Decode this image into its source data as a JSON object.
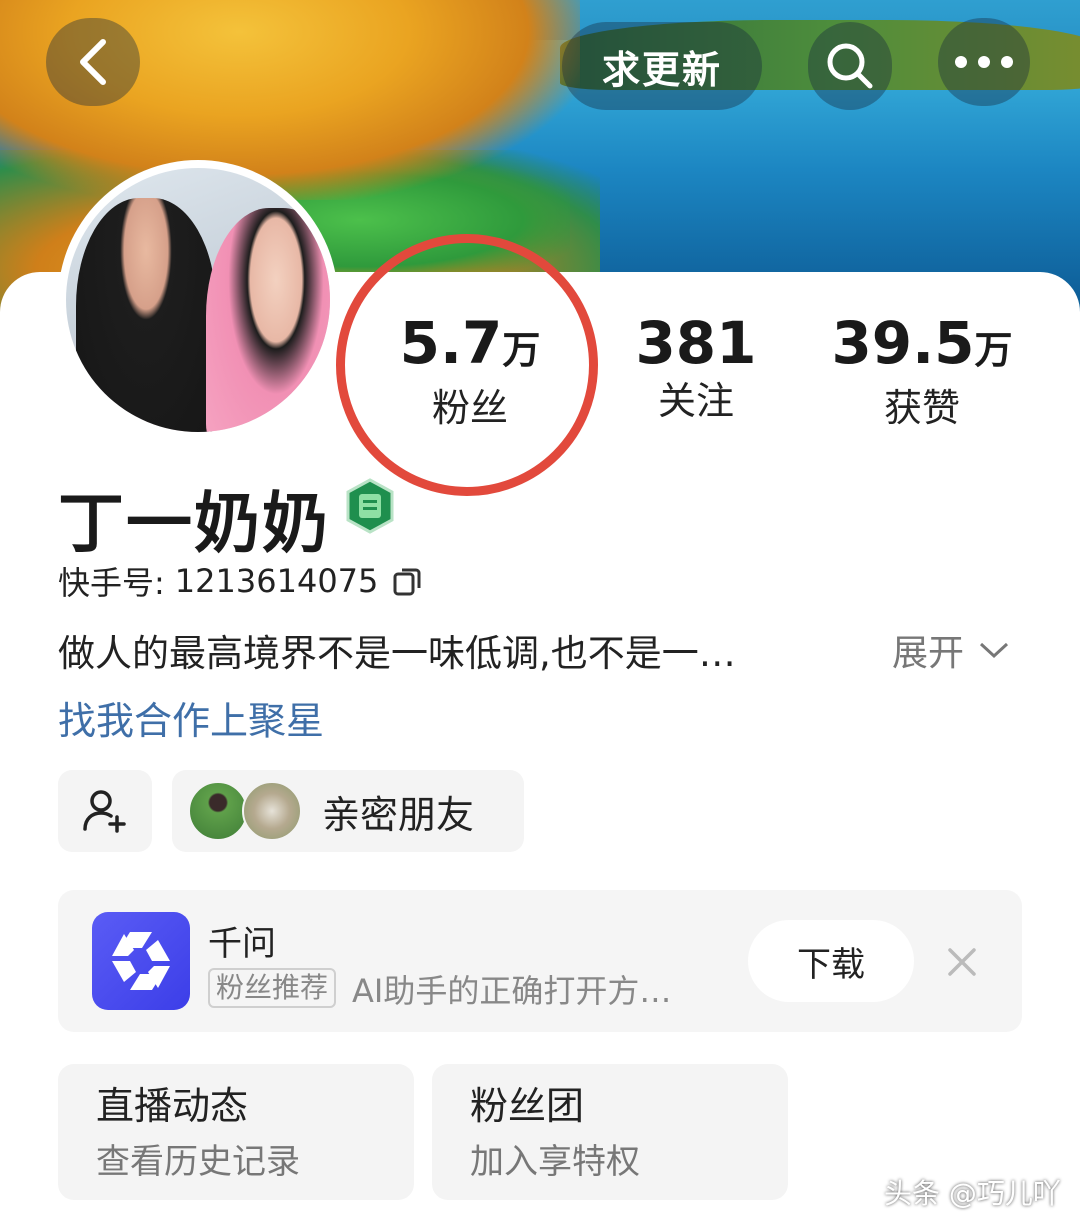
{
  "header": {
    "title": "求更新",
    "back_icon": "chevron-left-icon",
    "search_icon": "search-icon",
    "more_icon": "more-horizontal-icon"
  },
  "stats": {
    "fans": {
      "number": "5.7",
      "unit": "万",
      "label": "粉丝"
    },
    "following": {
      "number": "381",
      "unit": "",
      "label": "关注"
    },
    "likes": {
      "number": "39.5",
      "unit": "万",
      "label": "获赞"
    },
    "highlight_color": "#e2493c"
  },
  "profile": {
    "name": "丁一奶奶",
    "id_label": "快手号:",
    "id_value": "1213614075",
    "bio": "做人的最高境界不是一味低调,也不是一…",
    "expand_label": "展开",
    "cooperate_link": "找我合作上聚星",
    "link_color": "#3f6fa8"
  },
  "friends": {
    "label": "亲密朋友",
    "add_icon": "add-user-icon"
  },
  "promo": {
    "app_name": "千问",
    "tag": "粉丝推荐",
    "desc": "AI助手的正确打开方…",
    "download_label": "下载",
    "icon_color": "#4a4cf0"
  },
  "tiles": [
    {
      "title": "直播动态",
      "sub": "查看历史记录"
    },
    {
      "title": "粉丝团",
      "sub": "加入享特权"
    }
  ],
  "watermark": "头条 @巧儿吖"
}
